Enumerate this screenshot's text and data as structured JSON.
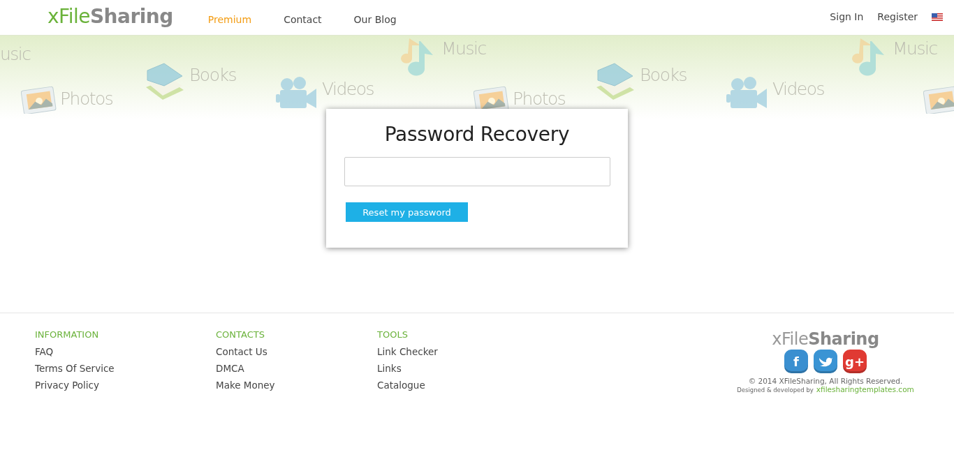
{
  "header": {
    "logo": {
      "light": "xFile",
      "bold": "Sharing"
    },
    "nav": [
      {
        "label": "Premium",
        "selected": true
      },
      {
        "label": "Contact",
        "selected": false
      },
      {
        "label": "Our Blog",
        "selected": false
      }
    ],
    "account": [
      "Sign In",
      "Register"
    ]
  },
  "banner": [
    {
      "kind": "music",
      "label": "usic",
      "icon": false
    },
    {
      "kind": "photos",
      "label": "Photos",
      "icon": true
    },
    {
      "kind": "books",
      "label": "Books",
      "icon": true
    },
    {
      "kind": "videos",
      "label": "Videos",
      "icon": true
    },
    {
      "kind": "music",
      "label": "Music",
      "icon": true
    },
    {
      "kind": "photos",
      "label": "Photos",
      "icon": true
    },
    {
      "kind": "books",
      "label": "Books",
      "icon": true
    },
    {
      "kind": "videos",
      "label": "Videos",
      "icon": true
    },
    {
      "kind": "music",
      "label": "Music",
      "icon": true
    },
    {
      "kind": "photos",
      "icon": true
    }
  ],
  "recovery": {
    "title": "Password Recovery",
    "button": "Reset my password"
  },
  "footer": {
    "columns": [
      {
        "heading": "INFORMATION",
        "links": [
          "FAQ",
          "Terms Of Service",
          "Privacy Policy"
        ]
      },
      {
        "heading": "CONTACTS",
        "links": [
          "Contact Us",
          "DMCA",
          "Make Money"
        ]
      },
      {
        "heading": "TOOLS",
        "links": [
          "Link Checker",
          "Links",
          "Catalogue"
        ]
      }
    ],
    "logo": {
      "light": "xFile",
      "bold": "Sharing"
    },
    "social": [
      {
        "kind": "facebook",
        "label": "f"
      },
      {
        "kind": "twitter"
      },
      {
        "kind": "google",
        "label": "g+"
      }
    ],
    "copyright": "© 2014 XFileSharing, All Rights Reserved.",
    "credit": "Designed & developed by",
    "credit_link": "xfilesharingtemplates.com"
  }
}
